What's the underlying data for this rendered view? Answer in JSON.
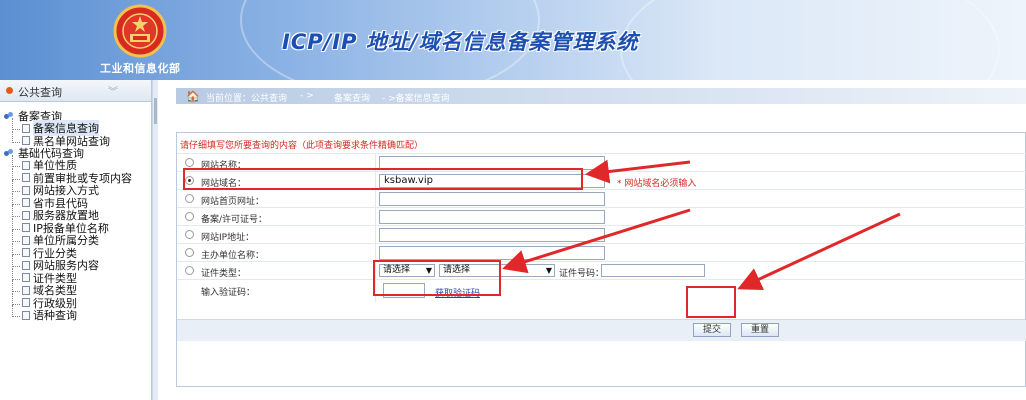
{
  "header": {
    "ministry_name": "工业和信息化部",
    "system_title": "ICP/IP 地址/域名信息备案管理系统"
  },
  "sidebar": {
    "title": "公共查询",
    "groups": [
      {
        "label": "备案查询",
        "items": [
          {
            "label": "备案信息查询",
            "active": true
          },
          {
            "label": "黑名单网站查询",
            "active": false
          }
        ]
      },
      {
        "label": "基础代码查询",
        "items": [
          {
            "label": "单位性质"
          },
          {
            "label": "前置审批或专项内容"
          },
          {
            "label": "网站接入方式"
          },
          {
            "label": "省市县代码"
          },
          {
            "label": "服务器放置地"
          },
          {
            "label": "IP报备单位名称"
          },
          {
            "label": "单位所属分类"
          },
          {
            "label": "行业分类"
          },
          {
            "label": "网站服务内容"
          },
          {
            "label": "证件类型"
          },
          {
            "label": "域名类型"
          },
          {
            "label": "行政级别"
          },
          {
            "label": "语种查询"
          }
        ]
      }
    ]
  },
  "breadcrumb": {
    "current": "当前位置：公共查询",
    "sep1": "- >",
    "level2": "备案查询",
    "level3": "- >备案信息查询"
  },
  "form": {
    "notice": "请仔细填写您所要查询的内容（此项查询要求条件精确匹配）",
    "fields": {
      "site_name": {
        "label": "网站名称：",
        "value": ""
      },
      "site_domain": {
        "label": "网站域名：",
        "value": "ksbaw.vip",
        "error": "* 网站域名必须输入"
      },
      "site_homepage": {
        "label": "网站首页网址：",
        "value": ""
      },
      "license_no": {
        "label": "备案/许可证号：",
        "value": ""
      },
      "site_ip": {
        "label": "网站IP地址：",
        "value": ""
      },
      "sponsor": {
        "label": "主办单位名称：",
        "value": ""
      },
      "cert_type": {
        "label": "证件类型：",
        "select1": "请选择",
        "select2": "请选择",
        "cert_no_label": "证件号码："
      },
      "captcha": {
        "label": "输入验证码：",
        "value": "",
        "refresh": "获取验证码"
      }
    },
    "submit_label": "提交",
    "reset_label": "重置"
  }
}
